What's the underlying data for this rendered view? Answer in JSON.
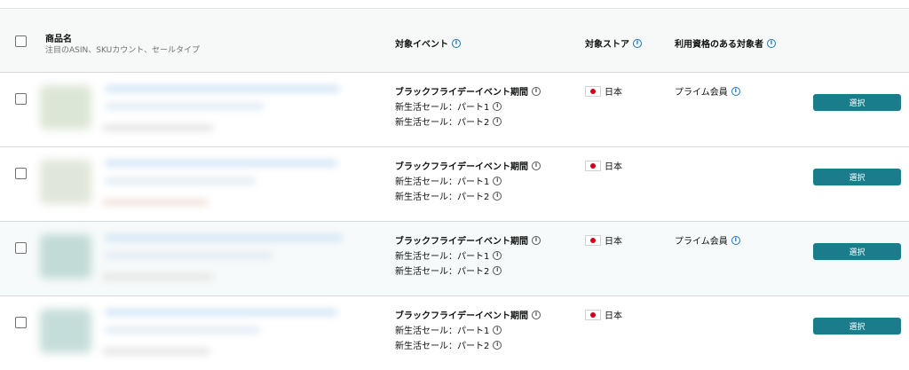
{
  "header": {
    "product_name": "商品名",
    "product_sub": "注目のASIN、SKUカウント、セールタイプ",
    "event": "対象イベント",
    "store": "対象ストア",
    "audience": "利用資格のある対象者"
  },
  "rows": [
    {
      "events": [
        "ブラックフライデーイベント期間",
        "新生活セール：パート1",
        "新生活セール：パート2"
      ],
      "store": "日本",
      "audience": "プライム会員",
      "button": "選択"
    },
    {
      "events": [
        "ブラックフライデーイベント期間",
        "新生活セール：パート1",
        "新生活セール：パート2"
      ],
      "store": "日本",
      "audience": "",
      "button": "選択"
    },
    {
      "events": [
        "ブラックフライデーイベント期間",
        "新生活セール：パート1",
        "新生活セール：パート2"
      ],
      "store": "日本",
      "audience": "プライム会員",
      "button": "選択"
    },
    {
      "events": [
        "ブラックフライデーイベント期間",
        "新生活セール：パート1",
        "新生活セール：パート2"
      ],
      "store": "日本",
      "audience": "",
      "button": "選択"
    }
  ],
  "icons": {
    "info": "i"
  },
  "colors": {
    "accent": "#1b7c8c",
    "info_blue": "#1b74b8",
    "flag_red": "#d0021b"
  }
}
